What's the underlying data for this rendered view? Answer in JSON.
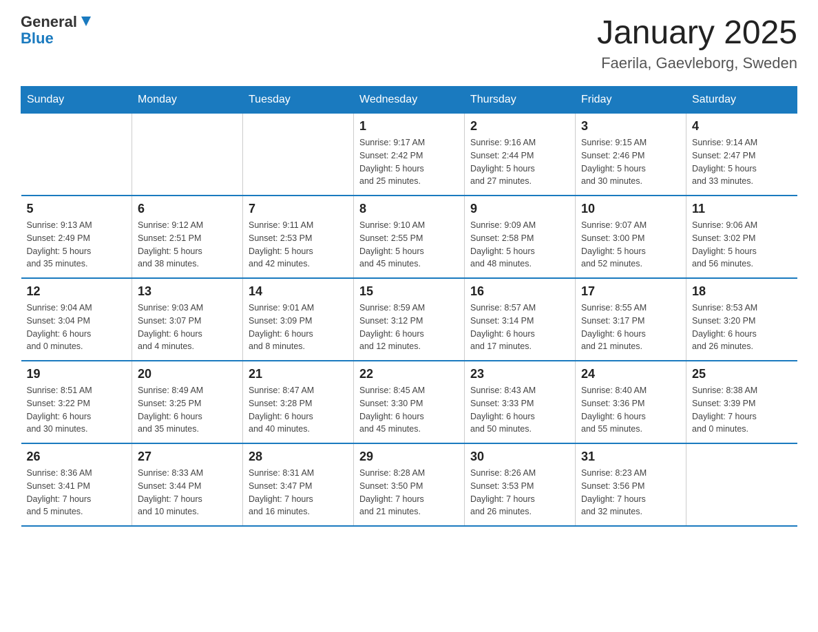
{
  "header": {
    "logo_general": "General",
    "logo_blue": "Blue",
    "title": "January 2025",
    "subtitle": "Faerila, Gaevleborg, Sweden"
  },
  "days_of_week": [
    "Sunday",
    "Monday",
    "Tuesday",
    "Wednesday",
    "Thursday",
    "Friday",
    "Saturday"
  ],
  "weeks": [
    {
      "days": [
        {
          "number": "",
          "info": ""
        },
        {
          "number": "",
          "info": ""
        },
        {
          "number": "",
          "info": ""
        },
        {
          "number": "1",
          "info": "Sunrise: 9:17 AM\nSunset: 2:42 PM\nDaylight: 5 hours\nand 25 minutes."
        },
        {
          "number": "2",
          "info": "Sunrise: 9:16 AM\nSunset: 2:44 PM\nDaylight: 5 hours\nand 27 minutes."
        },
        {
          "number": "3",
          "info": "Sunrise: 9:15 AM\nSunset: 2:46 PM\nDaylight: 5 hours\nand 30 minutes."
        },
        {
          "number": "4",
          "info": "Sunrise: 9:14 AM\nSunset: 2:47 PM\nDaylight: 5 hours\nand 33 minutes."
        }
      ]
    },
    {
      "days": [
        {
          "number": "5",
          "info": "Sunrise: 9:13 AM\nSunset: 2:49 PM\nDaylight: 5 hours\nand 35 minutes."
        },
        {
          "number": "6",
          "info": "Sunrise: 9:12 AM\nSunset: 2:51 PM\nDaylight: 5 hours\nand 38 minutes."
        },
        {
          "number": "7",
          "info": "Sunrise: 9:11 AM\nSunset: 2:53 PM\nDaylight: 5 hours\nand 42 minutes."
        },
        {
          "number": "8",
          "info": "Sunrise: 9:10 AM\nSunset: 2:55 PM\nDaylight: 5 hours\nand 45 minutes."
        },
        {
          "number": "9",
          "info": "Sunrise: 9:09 AM\nSunset: 2:58 PM\nDaylight: 5 hours\nand 48 minutes."
        },
        {
          "number": "10",
          "info": "Sunrise: 9:07 AM\nSunset: 3:00 PM\nDaylight: 5 hours\nand 52 minutes."
        },
        {
          "number": "11",
          "info": "Sunrise: 9:06 AM\nSunset: 3:02 PM\nDaylight: 5 hours\nand 56 minutes."
        }
      ]
    },
    {
      "days": [
        {
          "number": "12",
          "info": "Sunrise: 9:04 AM\nSunset: 3:04 PM\nDaylight: 6 hours\nand 0 minutes."
        },
        {
          "number": "13",
          "info": "Sunrise: 9:03 AM\nSunset: 3:07 PM\nDaylight: 6 hours\nand 4 minutes."
        },
        {
          "number": "14",
          "info": "Sunrise: 9:01 AM\nSunset: 3:09 PM\nDaylight: 6 hours\nand 8 minutes."
        },
        {
          "number": "15",
          "info": "Sunrise: 8:59 AM\nSunset: 3:12 PM\nDaylight: 6 hours\nand 12 minutes."
        },
        {
          "number": "16",
          "info": "Sunrise: 8:57 AM\nSunset: 3:14 PM\nDaylight: 6 hours\nand 17 minutes."
        },
        {
          "number": "17",
          "info": "Sunrise: 8:55 AM\nSunset: 3:17 PM\nDaylight: 6 hours\nand 21 minutes."
        },
        {
          "number": "18",
          "info": "Sunrise: 8:53 AM\nSunset: 3:20 PM\nDaylight: 6 hours\nand 26 minutes."
        }
      ]
    },
    {
      "days": [
        {
          "number": "19",
          "info": "Sunrise: 8:51 AM\nSunset: 3:22 PM\nDaylight: 6 hours\nand 30 minutes."
        },
        {
          "number": "20",
          "info": "Sunrise: 8:49 AM\nSunset: 3:25 PM\nDaylight: 6 hours\nand 35 minutes."
        },
        {
          "number": "21",
          "info": "Sunrise: 8:47 AM\nSunset: 3:28 PM\nDaylight: 6 hours\nand 40 minutes."
        },
        {
          "number": "22",
          "info": "Sunrise: 8:45 AM\nSunset: 3:30 PM\nDaylight: 6 hours\nand 45 minutes."
        },
        {
          "number": "23",
          "info": "Sunrise: 8:43 AM\nSunset: 3:33 PM\nDaylight: 6 hours\nand 50 minutes."
        },
        {
          "number": "24",
          "info": "Sunrise: 8:40 AM\nSunset: 3:36 PM\nDaylight: 6 hours\nand 55 minutes."
        },
        {
          "number": "25",
          "info": "Sunrise: 8:38 AM\nSunset: 3:39 PM\nDaylight: 7 hours\nand 0 minutes."
        }
      ]
    },
    {
      "days": [
        {
          "number": "26",
          "info": "Sunrise: 8:36 AM\nSunset: 3:41 PM\nDaylight: 7 hours\nand 5 minutes."
        },
        {
          "number": "27",
          "info": "Sunrise: 8:33 AM\nSunset: 3:44 PM\nDaylight: 7 hours\nand 10 minutes."
        },
        {
          "number": "28",
          "info": "Sunrise: 8:31 AM\nSunset: 3:47 PM\nDaylight: 7 hours\nand 16 minutes."
        },
        {
          "number": "29",
          "info": "Sunrise: 8:28 AM\nSunset: 3:50 PM\nDaylight: 7 hours\nand 21 minutes."
        },
        {
          "number": "30",
          "info": "Sunrise: 8:26 AM\nSunset: 3:53 PM\nDaylight: 7 hours\nand 26 minutes."
        },
        {
          "number": "31",
          "info": "Sunrise: 8:23 AM\nSunset: 3:56 PM\nDaylight: 7 hours\nand 32 minutes."
        },
        {
          "number": "",
          "info": ""
        }
      ]
    }
  ]
}
